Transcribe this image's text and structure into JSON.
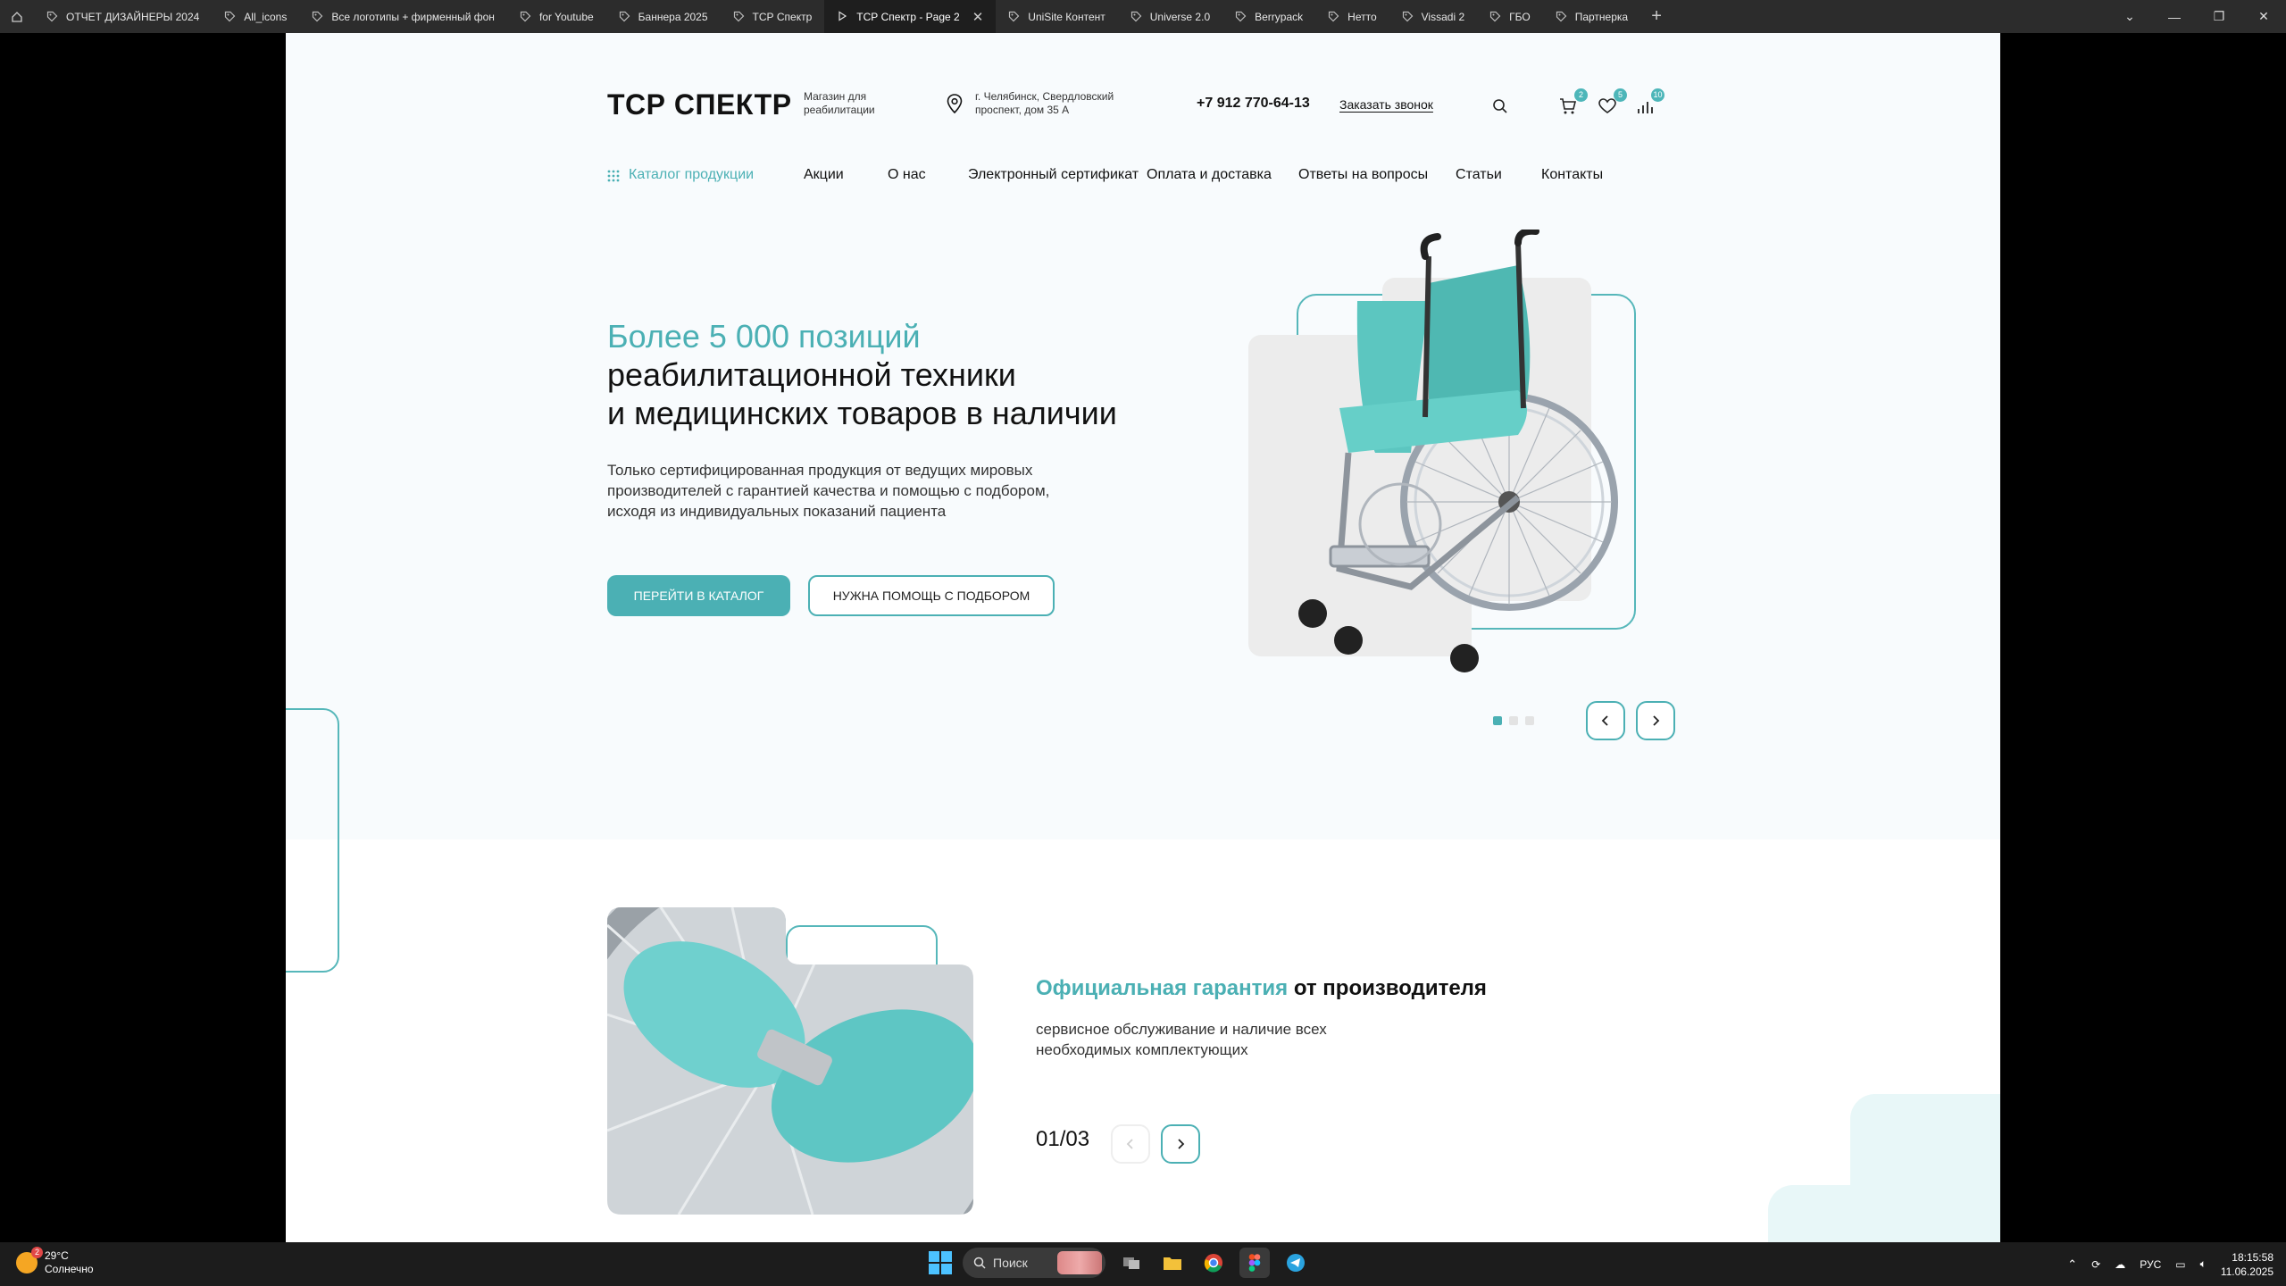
{
  "figma_tabs": [
    {
      "label": "ОТЧЕТ ДИЗАЙНЕРЫ 2024"
    },
    {
      "label": "All_icons"
    },
    {
      "label": "Все логотипы + фирменный фон"
    },
    {
      "label": "for Youtube"
    },
    {
      "label": "Баннера 2025"
    },
    {
      "label": "ТСР Спектр"
    },
    {
      "label": "ТСР Спектр - Page 2",
      "active": true
    },
    {
      "label": "UniSite Контент"
    },
    {
      "label": "Universe 2.0"
    },
    {
      "label": "Berrypack"
    },
    {
      "label": "Нетто"
    },
    {
      "label": "Vissadi 2"
    },
    {
      "label": "ГБО"
    },
    {
      "label": "Партнерка"
    }
  ],
  "header": {
    "logo": "ТСР СПЕКТР",
    "tagline": "Магазин для реабилитации",
    "address": "г. Челябинск, Свердловский проспект, дом 35 А",
    "phone": "+7 912 770-64-13",
    "callback": "Заказать звонок",
    "cart_count": "2",
    "favorites_count": "5",
    "compare_count": "10"
  },
  "nav": {
    "items": [
      "Каталог продукции",
      "Акции",
      "О нас",
      "Электронный сертификат",
      "Оплата и доставка",
      "Ответы на вопросы",
      "Статьи",
      "Контакты"
    ]
  },
  "hero": {
    "title_highlight": "Более 5 000 позиций",
    "title_line2": "реабилитационной техники",
    "title_line3": "и медицинских товаров в наличии",
    "description": "Только сертифицированная продукция от ведущих мировых производителей с гарантией качества и помощью с подбором, исходя из индивидуальных показаний пациента",
    "btn_catalog": "ПЕРЕЙТИ В КАТАЛОГ",
    "btn_help": "НУЖНА ПОМОЩЬ С ПОДБОРОМ",
    "slides_total": 3,
    "slide_active": 1
  },
  "warranty": {
    "title_highlight": "Официальная гарантия",
    "title_rest": " от производителя",
    "subtitle": "сервисное обслуживание и наличие всех необходимых комплектующих",
    "counter": "01/03"
  },
  "taskbar": {
    "temperature": "29°C",
    "weather": "Солнечно",
    "weather_badge": "2",
    "search": "Поиск",
    "lang": "РУС",
    "time": "18:15:58",
    "date": "11.06.2025"
  },
  "colors": {
    "accent": "#4bb0b4",
    "figma_bar": "#2c2c2c",
    "taskbar": "#1c1c1c"
  }
}
